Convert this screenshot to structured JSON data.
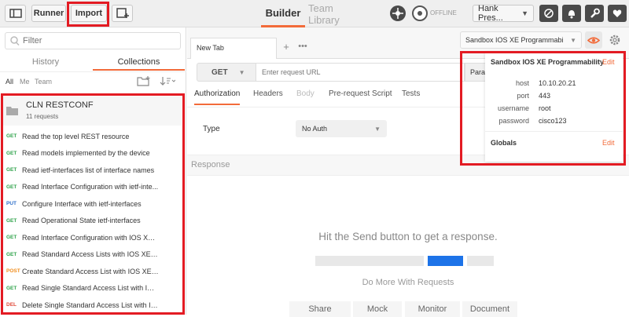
{
  "topbar": {
    "runner_label": "Runner",
    "import_label": "Import",
    "builder_label": "Builder",
    "team_library_label": "Team Library",
    "sync_status": "OFFLINE",
    "workspace_label": "Hank Pres..."
  },
  "sidebar": {
    "filter_placeholder": "Filter",
    "tab_history": "History",
    "tab_collections": "Collections",
    "filters": [
      "All",
      "Me",
      "Team"
    ],
    "collection": {
      "name": "CLN RESTCONF",
      "count": "11 requests"
    },
    "requests": [
      {
        "method": "GET",
        "title": "Read the top level REST resource"
      },
      {
        "method": "GET",
        "title": "Read models implemented by the device"
      },
      {
        "method": "GET",
        "title": "Read ietf-interfaces list of interface names"
      },
      {
        "method": "GET",
        "title": "Read Interface Configuration with ietf-inte..."
      },
      {
        "method": "PUT",
        "title": "Configure Interface with ietf-interfaces"
      },
      {
        "method": "GET",
        "title": "Read Operational State ietf-interfaces"
      },
      {
        "method": "GET",
        "title": "Read Interface Configuration with IOS XE ..."
      },
      {
        "method": "GET",
        "title": "Read Standard Access Lists with IOS XE N..."
      },
      {
        "method": "POST",
        "title": "Create Standard Access List with IOS XE N..."
      },
      {
        "method": "GET",
        "title": "Read Single Standard Access List with IOS ..."
      },
      {
        "method": "DEL",
        "title": "Delete Single Standard Access List with IO..."
      }
    ],
    "method_colors": {
      "GET": "#2fa34b",
      "PUT": "#2e6fc9",
      "POST": "#f08c1c",
      "DEL": "#e04c3c"
    }
  },
  "main": {
    "tab_title": "New Tab",
    "method": "GET",
    "url_placeholder": "Enter request URL",
    "params_label": "Para",
    "subtabs": [
      "Authorization",
      "Headers",
      "Body",
      "Pre-request Script",
      "Tests"
    ],
    "type_label": "Type",
    "auth_type": "No Auth",
    "response_label": "Response",
    "response_hint": "Hit the Send button to get a response.",
    "do_more": "Do More With Requests",
    "actions": [
      "Share",
      "Mock",
      "Monitor",
      "Document"
    ]
  },
  "environment": {
    "selected": "Sandbox IOS XE Programmabi",
    "panel_title": "Sandbox IOS XE Programmability",
    "edit_label": "Edit",
    "vars": [
      {
        "key": "host",
        "value": "10.10.20.21"
      },
      {
        "key": "port",
        "value": "443"
      },
      {
        "key": "username",
        "value": "root"
      },
      {
        "key": "password",
        "value": "cisco123"
      }
    ],
    "globals_label": "Globals",
    "globals_edit": "Edit"
  },
  "colors": {
    "accent": "#f26b3a",
    "highlight": "#e31b23",
    "send_blue": "#1d73e8"
  }
}
